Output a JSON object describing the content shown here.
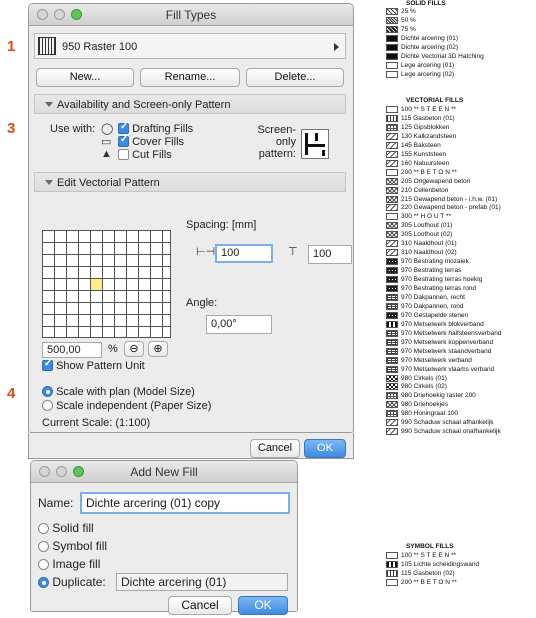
{
  "markers": [
    "1",
    "2",
    "3",
    "4"
  ],
  "fill_types_window": {
    "title": "Fill Types",
    "selected_type": "950 Raster 100",
    "buttons": {
      "new": "New...",
      "rename": "Rename...",
      "delete": "Delete..."
    },
    "availability": {
      "section_title": "Availability and Screen-only Pattern",
      "use_with_label": "Use with:",
      "drafting_fills": {
        "label": "Drafting Fills",
        "checked": true
      },
      "cover_fills": {
        "label": "Cover Fills",
        "checked": true
      },
      "cut_fills": {
        "label": "Cut Fills",
        "checked": false
      },
      "screen_only_label": "Screen-only",
      "pattern_label": "pattern:"
    },
    "vectorial": {
      "section_title": "Edit Vectorial Pattern",
      "spacing_label": "Spacing: [mm]",
      "spacing_h": "100",
      "spacing_v": "100",
      "angle_label": "Angle:",
      "angle_value": "0,00°",
      "zoom_value": "500,00",
      "zoom_unit": "%",
      "show_unit_label": "Show Pattern Unit",
      "show_unit_checked": true
    },
    "scale": {
      "model_label": "Scale with plan (Model Size)",
      "paper_label": "Scale independent (Paper Size)",
      "selected": "model",
      "current_scale": "Current Scale: (1:100)"
    },
    "footer": {
      "cancel": "Cancel",
      "ok": "OK"
    }
  },
  "add_fill_dialog": {
    "title": "Add New Fill",
    "name_label": "Name:",
    "name_value": "Dichte arcering (01) copy",
    "options": {
      "solid": "Solid fill",
      "symbol": "Symbol fill",
      "image": "Image fill",
      "duplicate": "Duplicate:"
    },
    "selected_option": "duplicate",
    "duplicate_value": "Dichte arcering (01)",
    "cancel": "Cancel",
    "ok": "OK"
  },
  "fill_list": {
    "solid_header": "SOLID FILLS",
    "solid": [
      {
        "label": "25 %",
        "pattern": "d25"
      },
      {
        "label": "50 %",
        "pattern": "d50"
      },
      {
        "label": "75 %",
        "pattern": "d75"
      },
      {
        "label": "Dichte arcering (01)",
        "pattern": "solid"
      },
      {
        "label": "Dichte arcering (02)",
        "pattern": "solid"
      },
      {
        "label": "Dichte Vectorial 3D Hatching",
        "pattern": "solid"
      },
      {
        "label": "Lege arcering (01)",
        "pattern": "empty"
      },
      {
        "label": "Lege arcering (02)",
        "pattern": "empty"
      }
    ],
    "vectorial_header": "VECTORIAL FILLS",
    "vectorial": [
      {
        "label": "100 ** S T E E N **",
        "pattern": "empty"
      },
      {
        "label": "115 Gasbeton (01)",
        "pattern": "vert"
      },
      {
        "label": "125 Gipsblokken",
        "pattern": "gridp"
      },
      {
        "label": "130 Kalkzandsteen",
        "pattern": "diag"
      },
      {
        "label": "145 Baksteen",
        "pattern": "diag"
      },
      {
        "label": "155 Kunststeen",
        "pattern": "diag"
      },
      {
        "label": "160 Natuursteen",
        "pattern": "diag"
      },
      {
        "label": "200 ** B E T O N **",
        "pattern": "empty"
      },
      {
        "label": "205 Ongewapend beton",
        "pattern": "cross"
      },
      {
        "label": "210 Cellenbeton",
        "pattern": "cross"
      },
      {
        "label": "215 Gewapend beton - i.h.w. (01)",
        "pattern": "cross"
      },
      {
        "label": "220 Gewapend beton - prefab (01)",
        "pattern": "diag"
      },
      {
        "label": "300 ** H O U T **",
        "pattern": "empty"
      },
      {
        "label": "305 Loofhout (01)",
        "pattern": "cross"
      },
      {
        "label": "305 Loofhout (02)",
        "pattern": "cross"
      },
      {
        "label": "310 Naaldhout (01)",
        "pattern": "diag"
      },
      {
        "label": "310 Naaldhout (02)",
        "pattern": "diag"
      },
      {
        "label": "970 Bestrating mozaiek",
        "pattern": "heavy"
      },
      {
        "label": "970 Bestrating terras",
        "pattern": "heavy"
      },
      {
        "label": "970 Bestrating terras hoekig",
        "pattern": "heavy"
      },
      {
        "label": "970 Bestrating terras rond",
        "pattern": "heavy"
      },
      {
        "label": "970 Dakpannen, recht",
        "pattern": "brick"
      },
      {
        "label": "970 Dakpannen, rond",
        "pattern": "brick"
      },
      {
        "label": "970 Gestapelde stenen",
        "pattern": "heavy"
      },
      {
        "label": "970 Metselwerk blokverband",
        "pattern": "bars"
      },
      {
        "label": "970 Metselwerk halfsteensverband",
        "pattern": "brick"
      },
      {
        "label": "970 Metselwerk koppenverband",
        "pattern": "brick"
      },
      {
        "label": "970 Metselwerk staandverband",
        "pattern": "brick"
      },
      {
        "label": "970 Metselwerk verband",
        "pattern": "brick"
      },
      {
        "label": "970 Metselwerk vlaams verband",
        "pattern": "brick"
      },
      {
        "label": "980 Cirkels (01)",
        "pattern": "checker"
      },
      {
        "label": "980 Cirkels (02)",
        "pattern": "checker"
      },
      {
        "label": "980 Driehoekig raster 200",
        "pattern": "gridp"
      },
      {
        "label": "980 Driehoekjes",
        "pattern": "cross"
      },
      {
        "label": "980 Honingraat 100",
        "pattern": "gridp"
      },
      {
        "label": "990 Schaduw schaal afhankelijk",
        "pattern": "diag"
      },
      {
        "label": "990 Schaduw schaal onafhankelijk",
        "pattern": "diag"
      }
    ],
    "symbol_header": "SYMBOL FILLS",
    "symbol": [
      {
        "label": "100 ** S T E E N **",
        "pattern": "empty"
      },
      {
        "label": "105 Lichte scheidingswand",
        "pattern": "bars"
      },
      {
        "label": "115 Gasbeton (02)",
        "pattern": "vert"
      },
      {
        "label": "200 ** B E T O N **",
        "pattern": "empty"
      }
    ]
  }
}
